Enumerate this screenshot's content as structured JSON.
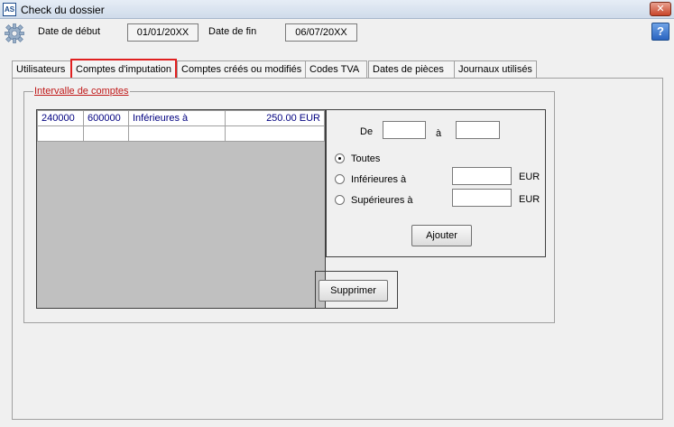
{
  "window": {
    "title": "Check du dossier",
    "app_icon": "AS",
    "close_glyph": "✕"
  },
  "dates": {
    "start_label": "Date de début",
    "start_value": "01/01/20XX",
    "end_label": "Date de fin",
    "end_value": "06/07/20XX",
    "help_glyph": "?"
  },
  "tabs": [
    {
      "label": "Utilisateurs"
    },
    {
      "label": "Comptes d'imputation",
      "active": true
    },
    {
      "label": "Comptes créés ou modifiés"
    },
    {
      "label": "Codes TVA"
    },
    {
      "label": "Dates de pièces"
    },
    {
      "label": "Journaux utilisés"
    }
  ],
  "group": {
    "title": "Intervalle de comptes",
    "rows": [
      {
        "from": "240000",
        "to": "600000",
        "condition": "Inférieures à",
        "amount": "250.00 EUR"
      },
      {
        "from": "",
        "to": "",
        "condition": "",
        "amount": ""
      }
    ],
    "filter": {
      "de_label": "De",
      "a_label": "à",
      "options": [
        {
          "label": "Toutes",
          "checked": true
        },
        {
          "label": "Inférieures à",
          "unit": "EUR"
        },
        {
          "label": "Supérieures à",
          "unit": "EUR"
        }
      ],
      "add_label": "Ajouter"
    },
    "delete_label": "Supprimer"
  }
}
